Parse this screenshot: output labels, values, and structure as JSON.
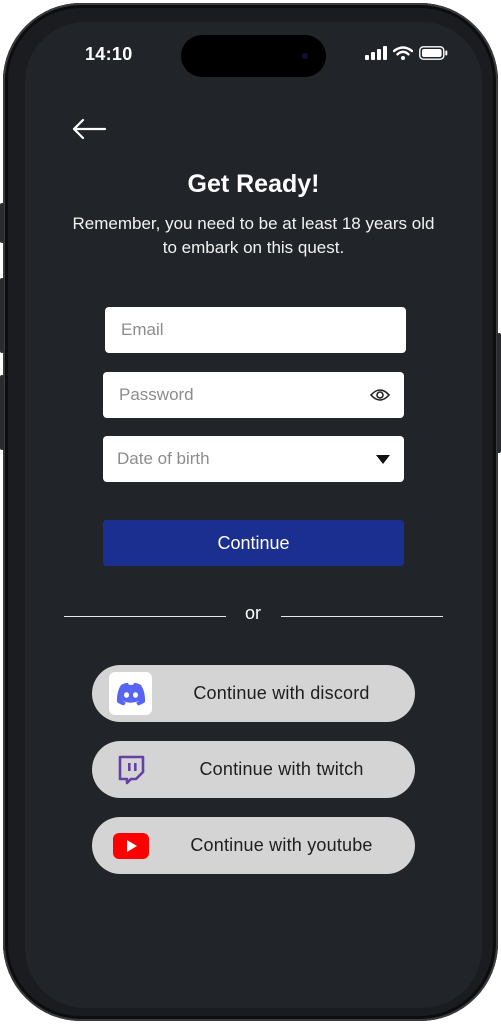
{
  "status_bar": {
    "time": "14:10",
    "icons": [
      "signal-icon",
      "wifi-icon",
      "battery-icon"
    ]
  },
  "header": {
    "back_icon": "arrow-left-icon",
    "title": "Get Ready!",
    "subtitle": "Remember, you need to be at least 18 years old to embark on this quest."
  },
  "form": {
    "email": {
      "placeholder": "Email",
      "value": ""
    },
    "password": {
      "placeholder": "Password",
      "value": "",
      "toggle_icon": "eye-icon"
    },
    "dob": {
      "placeholder": "Date of birth",
      "value": "",
      "icon": "caret-down-icon"
    },
    "continue_label": "Continue"
  },
  "divider": {
    "label": "or"
  },
  "social": [
    {
      "label": "Continue with discord",
      "icon": "discord-icon",
      "color": "#5865F2"
    },
    {
      "label": "Continue with twitch",
      "icon": "twitch-icon",
      "color": "#6441A5"
    },
    {
      "label": "Continue with youtube",
      "icon": "youtube-icon",
      "color": "#FF0000"
    }
  ],
  "colors": {
    "background": "#212428",
    "primary_button": "#1A2F8F",
    "social_button": "#D4D4D4",
    "field": "#FFFFFF"
  }
}
